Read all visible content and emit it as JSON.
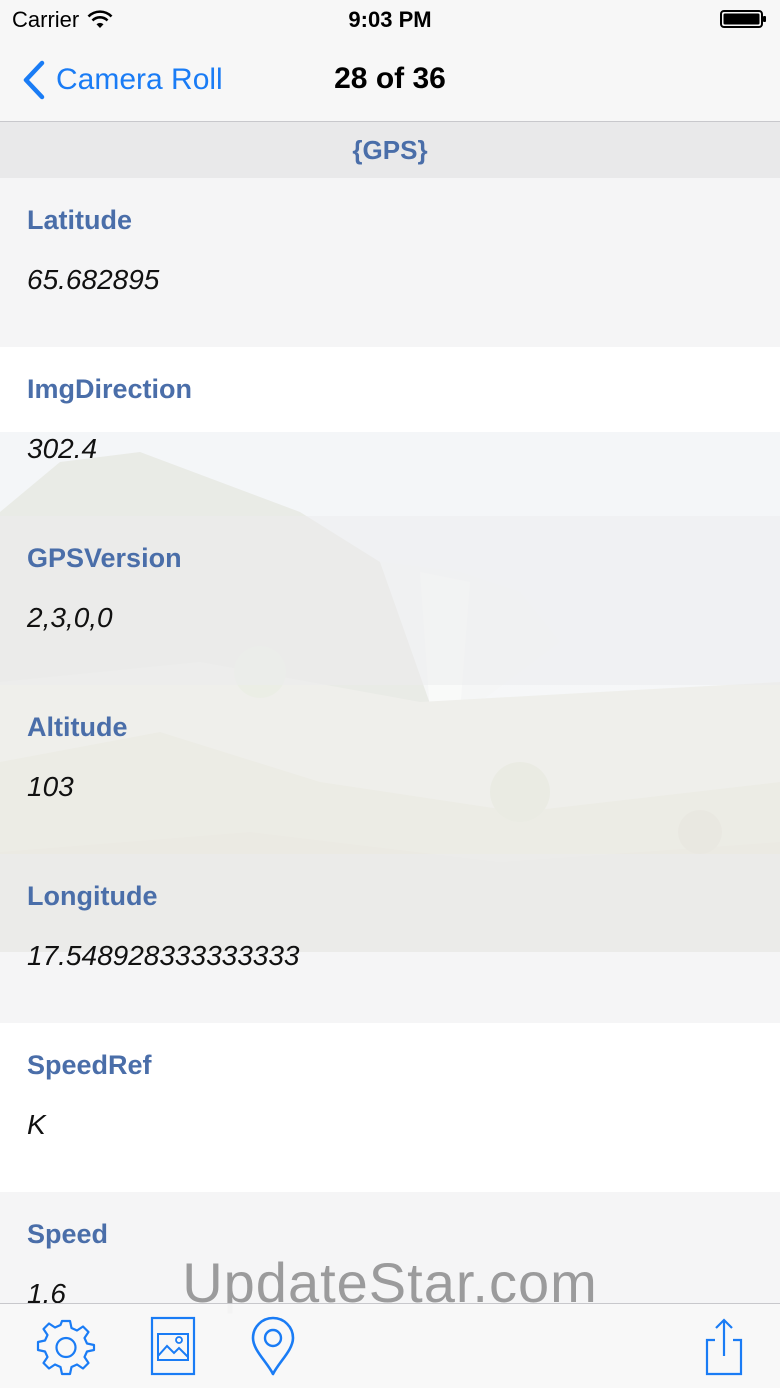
{
  "status_bar": {
    "carrier": "Carrier",
    "time": "9:03 PM",
    "icons": [
      "wifi-icon",
      "battery-icon"
    ]
  },
  "nav": {
    "back_label": "Camera Roll",
    "title": "28 of 36",
    "back_icon": "chevron-left-icon"
  },
  "section": {
    "title": "{GPS}"
  },
  "rows": [
    {
      "label": "Latitude",
      "value": "65.682895"
    },
    {
      "label": "ImgDirection",
      "value": "302.4"
    },
    {
      "label": "GPSVersion",
      "value": "2,3,0,0"
    },
    {
      "label": "Altitude",
      "value": "103"
    },
    {
      "label": "Longitude",
      "value": "17.548928333333333"
    },
    {
      "label": "SpeedRef",
      "value": "K"
    },
    {
      "label": "Speed",
      "value": "1.6"
    }
  ],
  "watermark": "UpdateStar.com",
  "toolbar": {
    "icons": [
      "settings-gear-icon",
      "photo-icon",
      "map-pin-icon",
      "share-icon"
    ]
  },
  "colors": {
    "accent": "#1a7cf5",
    "label": "#4a6ea9",
    "section_bg": "#e9e9ea"
  }
}
